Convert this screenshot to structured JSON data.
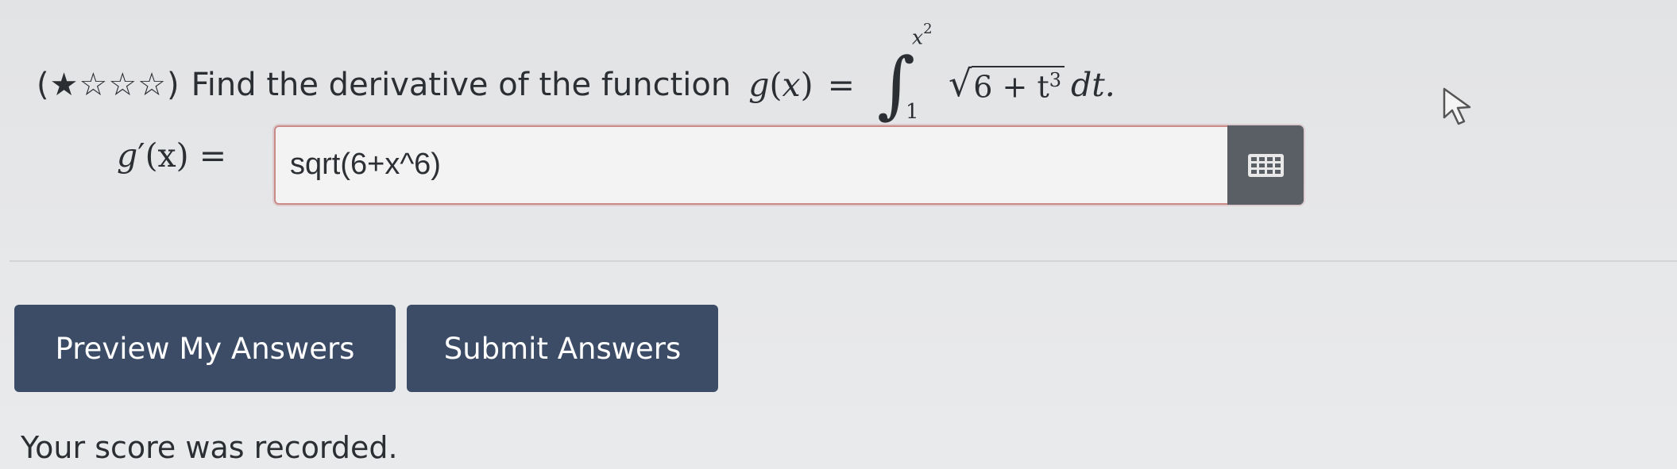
{
  "problem": {
    "stars": "(★☆☆☆)",
    "text": "Find the derivative of the function",
    "function_name": "g",
    "variable": "x",
    "upper_limit_base": "x",
    "upper_limit_exp": "2",
    "lower_limit": "1",
    "integrand_base": "6 + t",
    "integrand_exp": "3",
    "differential": "dt."
  },
  "answer": {
    "label_fn": "g",
    "label_arg": "(x) =",
    "value": "sqrt(6+x^6)"
  },
  "buttons": {
    "preview": "Preview My Answers",
    "submit": "Submit Answers"
  },
  "status": {
    "score_message": "Your score was recorded."
  }
}
